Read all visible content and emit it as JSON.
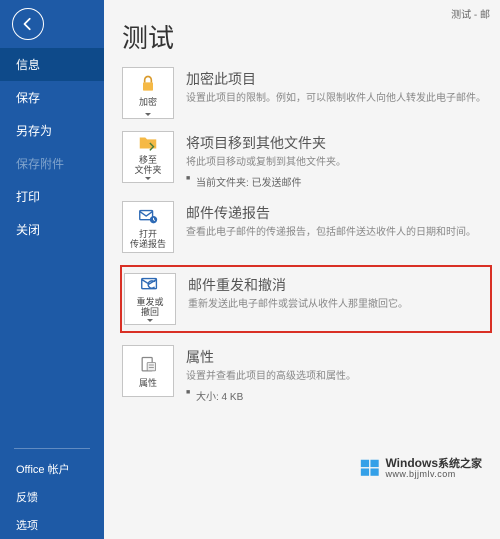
{
  "breadcrumb": "测试  -  邮",
  "page_title": "测试",
  "sidebar": {
    "items": [
      {
        "label": "信息",
        "active": true
      },
      {
        "label": "保存"
      },
      {
        "label": "另存为"
      },
      {
        "label": "保存附件",
        "disabled": true
      },
      {
        "label": "打印"
      },
      {
        "label": "关闭"
      }
    ],
    "bottom": [
      {
        "label": "Office 帐户"
      },
      {
        "label": "反馈"
      },
      {
        "label": "选项"
      }
    ]
  },
  "options": [
    {
      "tile_label": "加密",
      "title": "加密此项目",
      "desc": "设置此项目的限制。例如，可以限制收件人向他人转发此电子邮件。"
    },
    {
      "tile_label": "移至\n文件夹",
      "title": "将项目移到其他文件夹",
      "desc": "将此项目移动或复制到其他文件夹。",
      "bullet": "当前文件夹:  已发送邮件"
    },
    {
      "tile_label": "打开\n传递报告",
      "title": "邮件传递报告",
      "desc": "查看此电子邮件的传递报告，包括邮件送达收件人的日期和时间。"
    },
    {
      "tile_label": "重发或\n撤回",
      "title": "邮件重发和撤消",
      "desc": "重新发送此电子邮件或尝试从收件人那里撤回它。",
      "highlighted": true
    },
    {
      "tile_label": "属性",
      "title": "属性",
      "desc": "设置并查看此项目的高级选项和属性。",
      "bullet": "大小:  4 KB"
    }
  ],
  "watermark": {
    "brand": "Windows",
    "brand_cn": "系统之家",
    "url": "www.bjjmlv.com"
  }
}
